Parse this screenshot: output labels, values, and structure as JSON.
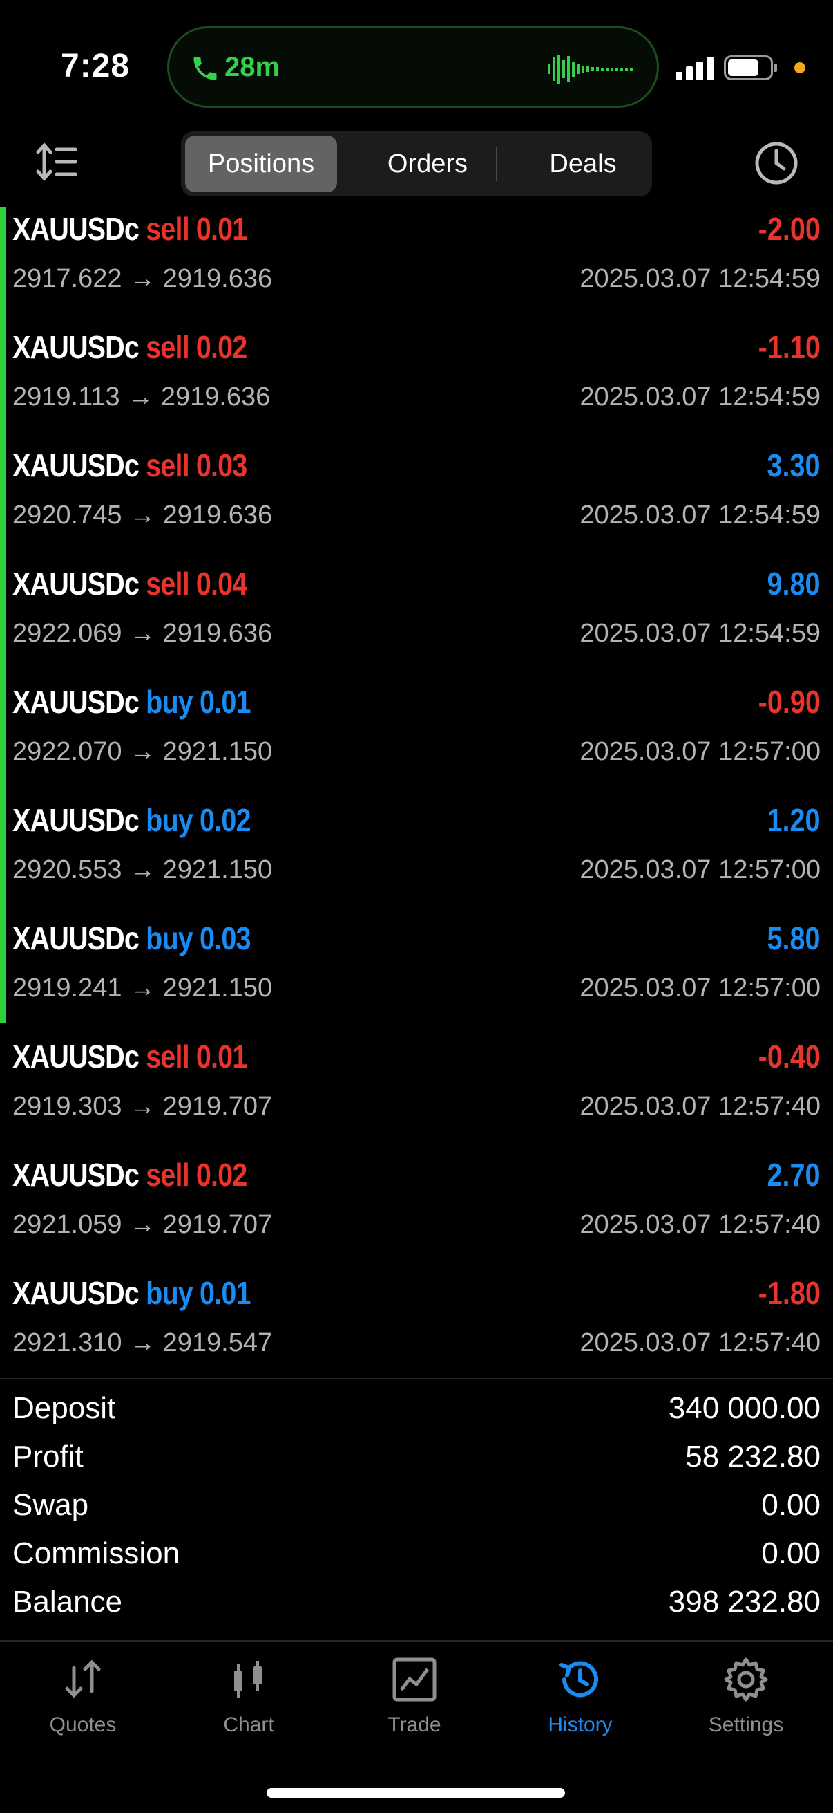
{
  "status_bar": {
    "time": "7:28",
    "call_duration": "28m",
    "accent_call": "#35d049"
  },
  "tabs_segmented": {
    "positions": "Positions",
    "orders": "Orders",
    "deals": "Deals",
    "selected": "Positions"
  },
  "deals": [
    {
      "symbol": "XAUUSDc",
      "side": "sell",
      "volume": "0.01",
      "open": "2917.622",
      "close": "2919.636",
      "profit": "-2.00",
      "time": "2025.03.07 12:54:59"
    },
    {
      "symbol": "XAUUSDc",
      "side": "sell",
      "volume": "0.02",
      "open": "2919.113",
      "close": "2919.636",
      "profit": "-1.10",
      "time": "2025.03.07 12:54:59"
    },
    {
      "symbol": "XAUUSDc",
      "side": "sell",
      "volume": "0.03",
      "open": "2920.745",
      "close": "2919.636",
      "profit": "3.30",
      "time": "2025.03.07 12:54:59"
    },
    {
      "symbol": "XAUUSDc",
      "side": "sell",
      "volume": "0.04",
      "open": "2922.069",
      "close": "2919.636",
      "profit": "9.80",
      "time": "2025.03.07 12:54:59"
    },
    {
      "symbol": "XAUUSDc",
      "side": "buy",
      "volume": "0.01",
      "open": "2922.070",
      "close": "2921.150",
      "profit": "-0.90",
      "time": "2025.03.07 12:57:00"
    },
    {
      "symbol": "XAUUSDc",
      "side": "buy",
      "volume": "0.02",
      "open": "2920.553",
      "close": "2921.150",
      "profit": "1.20",
      "time": "2025.03.07 12:57:00"
    },
    {
      "symbol": "XAUUSDc",
      "side": "buy",
      "volume": "0.03",
      "open": "2919.241",
      "close": "2921.150",
      "profit": "5.80",
      "time": "2025.03.07 12:57:00"
    },
    {
      "symbol": "XAUUSDc",
      "side": "sell",
      "volume": "0.01",
      "open": "2919.303",
      "close": "2919.707",
      "profit": "-0.40",
      "time": "2025.03.07 12:57:40"
    },
    {
      "symbol": "XAUUSDc",
      "side": "sell",
      "volume": "0.02",
      "open": "2921.059",
      "close": "2919.707",
      "profit": "2.70",
      "time": "2025.03.07 12:57:40"
    },
    {
      "symbol": "XAUUSDc",
      "side": "buy",
      "volume": "0.01",
      "open": "2921.310",
      "close": "2919.547",
      "profit": "-1.80",
      "time": "2025.03.07 12:57:40"
    }
  ],
  "summary": [
    {
      "label": "Deposit",
      "value": "340 000.00"
    },
    {
      "label": "Profit",
      "value": "58 232.80"
    },
    {
      "label": "Swap",
      "value": "0.00"
    },
    {
      "label": "Commission",
      "value": "0.00"
    },
    {
      "label": "Balance",
      "value": "398 232.80"
    }
  ],
  "tabbar": [
    {
      "label": "Quotes",
      "icon": "quotes-icon"
    },
    {
      "label": "Chart",
      "icon": "chart-icon"
    },
    {
      "label": "Trade",
      "icon": "trade-icon"
    },
    {
      "label": "History",
      "icon": "history-icon",
      "active": true
    },
    {
      "label": "Settings",
      "icon": "settings-icon"
    }
  ],
  "colors": {
    "sell": "#e8342c",
    "buy": "#1a8bf0",
    "accent": "#1a8bf0",
    "open_position_marker": "#2ed13c"
  }
}
